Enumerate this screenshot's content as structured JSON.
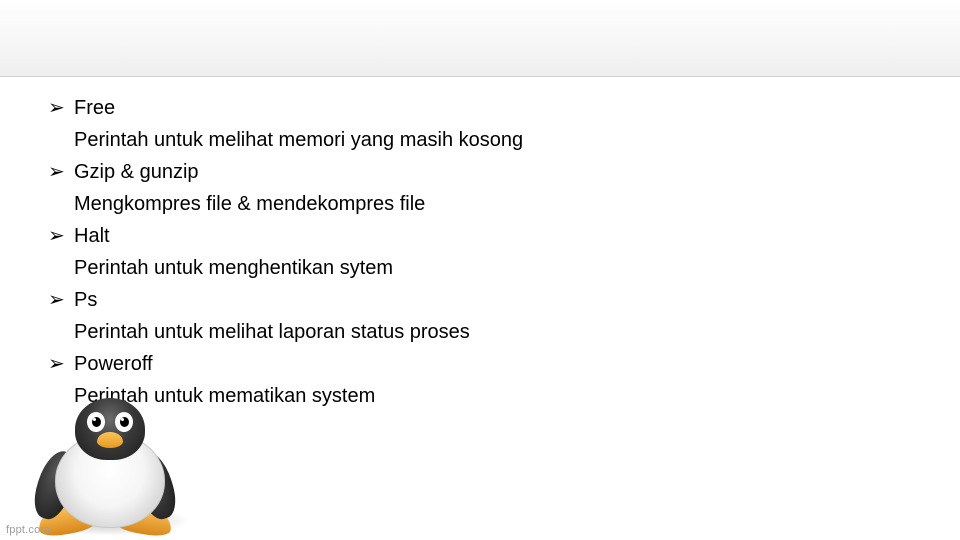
{
  "bullet_glyph": "➢",
  "items": [
    {
      "title": "Free",
      "desc": "Perintah untuk melihat memori yang masih kosong"
    },
    {
      "title": "Gzip & gunzip",
      "desc": "Mengkompres file & mendekompres file"
    },
    {
      "title": "Halt",
      "desc": "Perintah untuk menghentikan sytem"
    },
    {
      "title": "Ps",
      "desc": "Perintah untuk melihat laporan status proses"
    },
    {
      "title": "Poweroff",
      "desc": "Perintah untuk mematikan system"
    }
  ],
  "watermark": "fppt.com"
}
